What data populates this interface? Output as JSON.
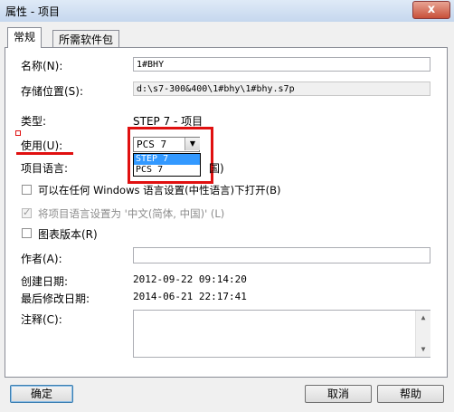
{
  "window": {
    "title": "属性 - 项目",
    "close_glyph": "x"
  },
  "tabs": [
    {
      "label": "常规"
    },
    {
      "label": "所需软件包"
    }
  ],
  "form": {
    "name_label": "名称(N):",
    "name_value": "1#BHY",
    "location_label": "存储位置(S):",
    "location_value": "d:\\s7-300&400\\1#bhy\\1#bhy.s7p",
    "type_label": "类型:",
    "type_value": "STEP 7 - 项目",
    "use_label": "使用(U):",
    "use_selected": "PCS 7",
    "use_options": [
      "STEP 7",
      "PCS 7"
    ],
    "lang_label": "项目语言:",
    "lang_value_partial": "国)",
    "check_open_any_lang": "可以在任何 Windows 语言设置(中性语言)下打开(B)",
    "check_set_lang": "将项目语言设置为 '中文(简体, 中国)' (L)",
    "check_chart_version": "图表版本(R)",
    "author_label": "作者(A):",
    "author_value": "",
    "created_label": "创建日期:",
    "created_value": "2012-09-22  09:14:20",
    "modified_label": "最后修改日期:",
    "modified_value": "2014-06-21  22:17:41",
    "comment_label": "注释(C):",
    "comment_value": ""
  },
  "buttons": {
    "ok": "确定",
    "cancel": "取消",
    "help": "帮助"
  },
  "colors": {
    "highlight_annotation": "#e01010",
    "selection": "#3399ff"
  }
}
